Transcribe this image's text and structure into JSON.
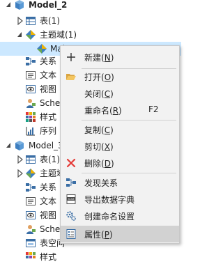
{
  "tree": {
    "model1": {
      "label": "Model_2"
    },
    "tables": {
      "label": "表(1)"
    },
    "subject_areas": {
      "label": "主题域(1)"
    },
    "main_area": {
      "label": "Mai"
    },
    "relations1": {
      "label": "关系"
    },
    "texts1": {
      "label": "文本"
    },
    "views1": {
      "label": "视图"
    },
    "schemas1": {
      "label": "Sche"
    },
    "styles1": {
      "label": "样式"
    },
    "sequences1": {
      "label": "序列"
    },
    "model2": {
      "label": "Model_3"
    },
    "tables2": {
      "label": "表(1)"
    },
    "subject_areas2": {
      "label": "主题域"
    },
    "relations2": {
      "label": "关系"
    },
    "texts2": {
      "label": "文本"
    },
    "views2": {
      "label": "视图"
    },
    "schemas2": {
      "label": "Sche"
    },
    "tablespaces2": {
      "label": "表空间"
    },
    "styles2": {
      "label": "样式"
    }
  },
  "menu": {
    "new": {
      "label": "新建",
      "key": "N"
    },
    "open": {
      "label": "打开",
      "key": "O"
    },
    "close": {
      "label": "关闭",
      "key": "C"
    },
    "rename": {
      "label": "重命名",
      "key": "R",
      "shortcut": "F2"
    },
    "copy": {
      "label": "复制",
      "key": "C"
    },
    "cut": {
      "label": "剪切",
      "key": "X"
    },
    "delete": {
      "label": "删除",
      "key": "D"
    },
    "discover": {
      "label": "发现关系"
    },
    "export_dict": {
      "label": "导出数据字典"
    },
    "naming_settings": {
      "label": "创建命名设置"
    },
    "properties": {
      "label": "属性",
      "key": "P"
    }
  },
  "colors": {
    "selection": "#cce8ff",
    "menu_bg": "#f2f2f2",
    "menu_highlight": "#d2d2d2",
    "delete_red": "#e53935"
  }
}
